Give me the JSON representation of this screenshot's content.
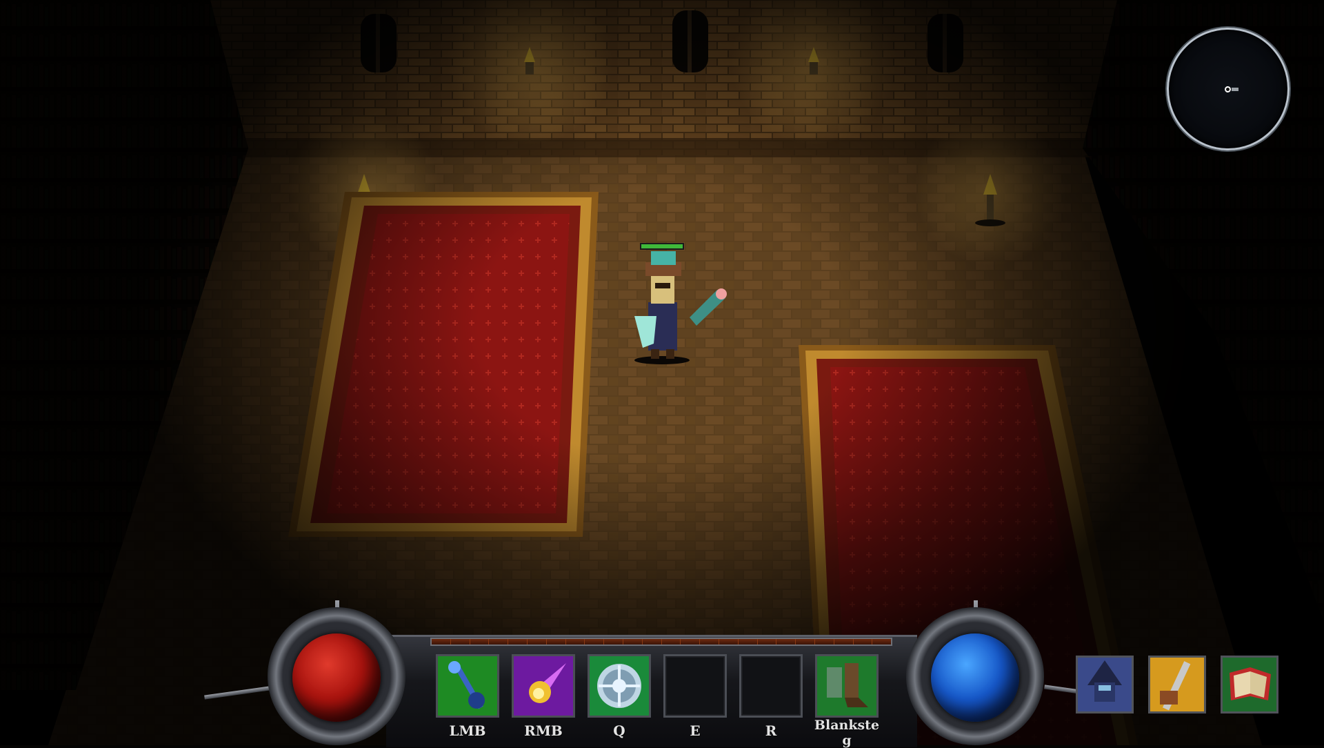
{
  "hud": {
    "skill_slots": [
      {
        "key": "LMB",
        "icon": "magic-staff-icon",
        "empty": false
      },
      {
        "key": "RMB",
        "icon": "fireball-icon",
        "empty": false
      },
      {
        "key": "Q",
        "icon": "arcane-shield-rune-icon",
        "empty": false
      },
      {
        "key": "E",
        "icon": "",
        "empty": true
      },
      {
        "key": "R",
        "icon": "",
        "empty": true
      },
      {
        "key": "Blankste\ng",
        "icon": "boots-icon",
        "empty": false
      }
    ],
    "orbs": {
      "health": {
        "fill": 1.0,
        "color": "#c4160f"
      },
      "mana": {
        "fill": 1.0,
        "color": "#1a67d6"
      }
    },
    "experience_fill": 0.0,
    "menu_buttons": [
      "character-portrait-icon",
      "inventory-bag-icon",
      "spellbook-icon"
    ]
  },
  "player": {
    "health_fill": 1.0,
    "health_color": "#3fb83a"
  },
  "minimap": {
    "shape": "circle",
    "player_marker": "player-marker-icon"
  },
  "colors": {
    "carpet_red": "#8e1512",
    "carpet_border": "#c08a2e",
    "floor_brick": "#5a3e1e",
    "wall_brick": "#6d4a22",
    "torch_flame": "#ffd23a"
  }
}
